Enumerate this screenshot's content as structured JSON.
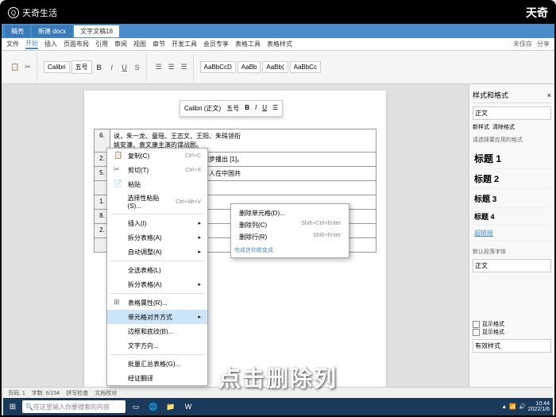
{
  "topbar": {
    "brand": "天奇生活",
    "right": "天奇"
  },
  "wps": {
    "tabs": [
      "稿壳",
      "新建 docx",
      "文字文稿18"
    ],
    "ribbon_tabs": [
      "文件",
      "开始",
      "插入",
      "页面布局",
      "引用",
      "审阅",
      "视图",
      "章节",
      "开发工具",
      "会员专享",
      "表格工具",
      "表格样式"
    ],
    "ribbon_right": [
      "未保存",
      "分享"
    ],
    "font": "Calibri",
    "size": "五号",
    "styles_preview": [
      "AaBbCcD",
      "AaBb",
      "AaBb(",
      "AaBbCc"
    ],
    "styles_labels": [
      "标题",
      "标题 1",
      "标题 2",
      "正文"
    ]
  },
  "mini_toolbar": {
    "font": "Calibri (正文)",
    "size": "五号"
  },
  "doc": {
    "rows": [
      "6.",
      "2.",
      "5.",
      "",
      "1.",
      "8.",
      "2.",
      ""
    ],
    "text1": "说，朱一龙、童瑶、王志文、王阳、朱珠领衔",
    "text2": "姚安濂、袁文康主演的谍战剧。",
    "text3": "日在央视八套播出，并在爱奇艺同步播出 [1]。",
    "text4": "说改编，讲述了林楠笙，朱怡贞等人在中国共",
    "text5": "完成信仰救变成"
  },
  "context_menu": {
    "items": [
      {
        "icon": "📋",
        "label": "复制(C)",
        "shortcut": "Ctrl+C"
      },
      {
        "icon": "✂",
        "label": "剪切(T)",
        "shortcut": "Ctrl+X"
      },
      {
        "icon": "📄",
        "label": "粘贴",
        "shortcut": ""
      },
      {
        "icon": "",
        "label": "选择性粘贴(S)...",
        "shortcut": "Ctrl+Alt+V"
      },
      {
        "icon": "",
        "label": "插入(I)",
        "arrow": true
      },
      {
        "icon": "",
        "label": "拆分表格(A)",
        "arrow": true
      },
      {
        "icon": "",
        "label": "自动调整(A)",
        "arrow": true
      },
      {
        "icon": "",
        "label": "全选表格(L)",
        "": ""
      },
      {
        "icon": "",
        "label": "拆分表格(A)",
        "arrow": true
      },
      {
        "icon": "⊞",
        "label": "表格属性(R)...",
        "": ""
      },
      {
        "icon": "",
        "label": "单元格对齐方式",
        "arrow": true,
        "hl": true
      },
      {
        "icon": "",
        "label": "边框和底纹(B)...",
        "": ""
      },
      {
        "icon": "",
        "label": "文字方向...",
        "": ""
      },
      {
        "icon": "",
        "label": "批量汇总表格(G)...",
        "badge": true
      },
      {
        "icon": "",
        "label": "经证翻译",
        "": ""
      }
    ]
  },
  "submenu": {
    "items": [
      {
        "label": "删除单元格(D)...",
        "shortcut": ""
      },
      {
        "label": "删除列(C)",
        "shortcut": "Shift+Ctrl+Enter"
      },
      {
        "label": "删除行(R)",
        "shortcut": "Shift+Enter"
      }
    ]
  },
  "side_panel": {
    "title": "样式和格式",
    "current": "正文",
    "clear": "清除格式",
    "hint": "请选择要应用的格式",
    "styles": [
      "标题 1",
      "标题 2",
      "标题 3",
      "标题 4",
      "超链接"
    ],
    "default_font_label": "默认段落字体",
    "default_font": "正文",
    "footer": [
      "新样式...",
      "显示格式",
      "显示格式",
      "有效样式"
    ]
  },
  "statusbar": {
    "page": "页码: 1",
    "words": "字数: 6/154",
    "spell": "拼写检查",
    "doc_check": "文档校对"
  },
  "taskbar": {
    "search_placeholder": "在这里输入你要搜索的内容",
    "time": "10:44",
    "date": "2022/1/6"
  },
  "subtitle": "点击删除列"
}
